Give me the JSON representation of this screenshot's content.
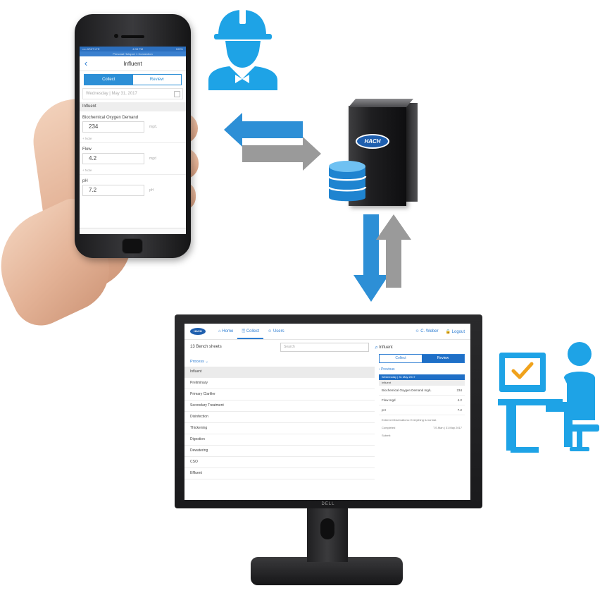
{
  "phone": {
    "status_carrier": "•••• AT&T LTE",
    "status_time": "4:08 PM",
    "status_battery": "100%",
    "subheader": "Personal Hotspot: 1 Connection",
    "back_icon": "chevron-left-icon",
    "title": "Influent",
    "tabs": {
      "collect": "Collect",
      "review": "Review"
    },
    "date": "Wednesday  |  May 31, 2017",
    "section": "Influent",
    "fields": [
      {
        "label": "Biochemical Oxygen Demand",
        "value": "234",
        "unit": "mg/L",
        "note": "+ Note"
      },
      {
        "label": "Flow",
        "value": "4.2",
        "unit": "mgd",
        "note": "+ Note"
      },
      {
        "label": "pH",
        "value": "7.2",
        "unit": "pH",
        "note": ""
      }
    ]
  },
  "server": {
    "logo_text": "HACH"
  },
  "icons": {
    "field_worker": "worker-hardhat-icon",
    "database": "database-icon",
    "office_user": "desk-user-icon",
    "arrows": "sync-arrows-icon"
  },
  "colors": {
    "accent_blue": "#2d8fd6",
    "arrow_gray": "#9a9a9a",
    "icon_blue": "#1ea3e6"
  },
  "monitor": {
    "brand": "DELL",
    "app": {
      "logo": "HACH",
      "nav": [
        "Home",
        "Collect",
        "Users"
      ],
      "active_nav": "Collect",
      "user": "C. Weber",
      "logout": "Logout"
    },
    "list": {
      "title": "13 Bench sheets",
      "search_placeholder": "Search",
      "filter": "Process",
      "items": [
        "Influent",
        "Preliminary",
        "Primary Clarifier",
        "Secondary Treatment",
        "Disinfection",
        "Thickening",
        "Digestion",
        "Dewatering",
        "CSO",
        "Effluent"
      ]
    },
    "detail": {
      "title": "Influent",
      "tabs": {
        "collect": "Collect",
        "review": "Review"
      },
      "previous": "Previous",
      "date_bar": "Wednesday | 31 May 2017",
      "group": "Influent",
      "rows": [
        {
          "label": "Biochemical Oxygen Demand",
          "unit": "mg/L",
          "value": "234"
        },
        {
          "label": "Flow",
          "unit": "mgd",
          "value": "4.2"
        },
        {
          "label": "pH",
          "unit": "",
          "value": "7.2"
        }
      ],
      "notes": "Entered Observations: Everything is normal.",
      "meta_label": "Completed",
      "meta_value": "T.S.Man | 31 May 2017",
      "submit": "Submit"
    }
  }
}
